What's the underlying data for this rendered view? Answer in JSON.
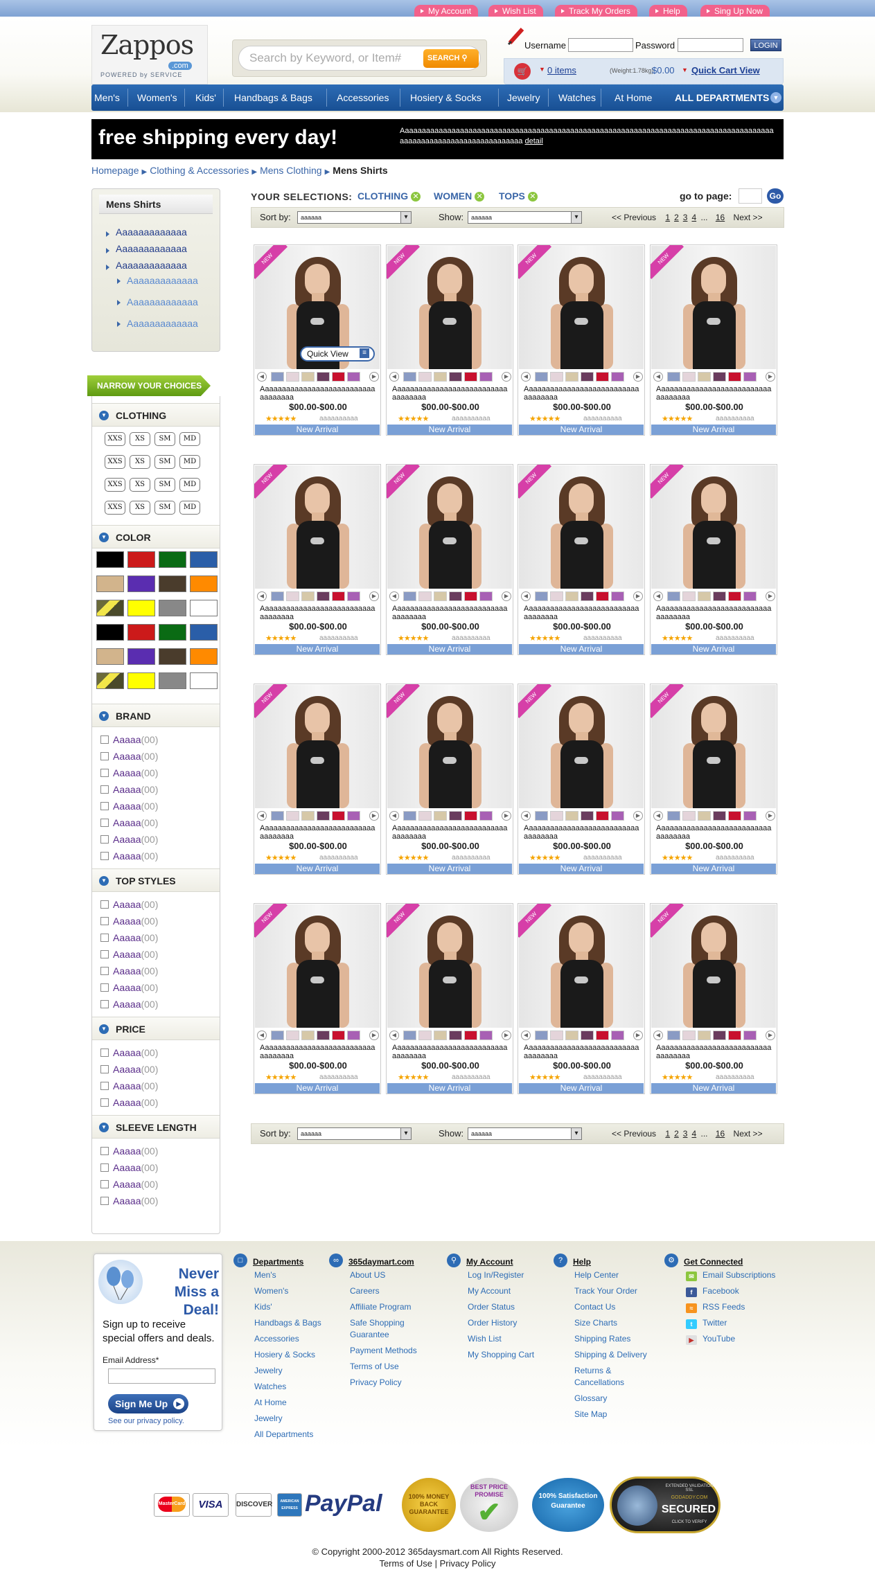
{
  "topbar": {
    "links": [
      "My Account",
      "Wish List",
      "Track My Orders",
      "Help",
      "Sing Up Now"
    ]
  },
  "header": {
    "logo": {
      "name": "Zappos",
      "suffix": ".com",
      "tagline": "POWERED by SERVICE"
    },
    "search": {
      "placeholder": "Search by Keyword, or Item#",
      "button": "SEARCH"
    },
    "login": {
      "username_label": "Username",
      "password_label": "Password",
      "button": "LOGIN"
    },
    "cart": {
      "items": "0 items",
      "weight": "(Weight:1.78kg)",
      "total": "$0.00",
      "quick_view": "Quick Cart View"
    }
  },
  "nav": {
    "items": [
      "Men's",
      "Women's",
      "Kids'",
      "Handbags & Bags",
      "Accessories",
      "Hosiery & Socks",
      "Jewelry",
      "Watches",
      "At Home"
    ],
    "all": "ALL DEPARTMENTS"
  },
  "banner": {
    "headline": "free shipping every day!",
    "text": "Aaaaaaaaaaaaaaaaaaaaaaaaaaaaaaaaaaaaaaaaaaaaaaaaaaaaaaaaaaaaaaaaaaaaaaaaaaaaaaaaaaaaaaaaaaaaaaaaaaaaaaaaaaaaaaaaaaaaa",
    "detail": "detail"
  },
  "breadcrumb": {
    "items": [
      "Homepage",
      "Clothing & Accessories",
      "Mens Clothing"
    ],
    "current": "Mens Shirts"
  },
  "sidebar": {
    "title": "Mens Shirts",
    "links": [
      "Aaaaaaaaaaaaa",
      "Aaaaaaaaaaaaa",
      "Aaaaaaaaaaaaa"
    ],
    "sublinks": [
      "Aaaaaaaaaaaaa",
      "Aaaaaaaaaaaaa",
      "Aaaaaaaaaaaaa"
    ],
    "narrow": "NARROW YOUR CHOICES",
    "sections": {
      "clothing": "CLOTHING",
      "color": "COLOR",
      "brand": "BRAND",
      "top_styles": "TOP STYLES",
      "price": "PRICE",
      "sleeve": "SLEEVE LENGTH"
    },
    "sizes": [
      "XXS",
      "XS",
      "SM",
      "MD"
    ],
    "colors": [
      "#000000",
      "#cc1a1a",
      "#0a6b14",
      "#2a5ea8",
      "#d2b48c",
      "#5a2db0",
      "#4a3c2c",
      "#ff8a00",
      "pattern",
      "#ffff00",
      "#888888",
      "#ffffff"
    ],
    "brand_item": "Aaaaa",
    "count": "(00)"
  },
  "selections": {
    "label": "YOUR SELECTIONS:",
    "items": [
      "CLOTHING",
      "WOMEN",
      "TOPS"
    ],
    "goto": "go to page:",
    "go": "Go"
  },
  "sortbar": {
    "sort_label": "Sort by:",
    "show_label": "Show:",
    "select_value": "aaaaaa",
    "prev": "<< Previous",
    "pages": [
      "1",
      "2",
      "3",
      "4"
    ],
    "ellipsis": "...",
    "last": "16",
    "next": "Next >>"
  },
  "product": {
    "ribbon": "NEW",
    "quick_view": "Quick View",
    "name": "Aaaaaaaaaaaaaaaaaaaaaaaaaaaaaaaaaaa",
    "price": "$00.00-$00.00",
    "stars": "★★★★★",
    "review": "aaaaaaaaaa",
    "new_arrival": "New Arrival",
    "swatches": [
      "#8a9bc4",
      "#e4d4da",
      "#d6c8a8",
      "#6a3c5e",
      "#c8102e",
      "#a860b4"
    ]
  },
  "footer": {
    "promo": {
      "title": "Never Miss a Deal!",
      "text": "Sign up to receive special offers and deals.",
      "email_label": "Email Address*",
      "button": "Sign Me Up",
      "privacy": "See our privacy policy."
    },
    "departments": {
      "title": "Departments",
      "links": [
        "Men's",
        "Women's",
        "Kids'",
        "Handbags & Bags",
        "Accessories",
        "Hosiery & Socks",
        "Jewelry",
        "Watches",
        "At Home",
        "Jewelry",
        "All Departments"
      ]
    },
    "site": {
      "title": "365daymart.com",
      "links": [
        "About US",
        "Careers",
        "Affiliate Program",
        "Safe Shopping",
        "Guarantee",
        "Payment Methods",
        "Terms of Use",
        "Privacy Policy"
      ]
    },
    "account": {
      "title": "My Account",
      "links": [
        "Log In/Register",
        "My Account",
        "Order Status",
        "Order History",
        "Wish List",
        "My Shopping Cart"
      ]
    },
    "help": {
      "title": "Help",
      "links": [
        "Help Center",
        "Track Your Order",
        "Contact Us",
        "Size Charts",
        "Shipping Rates",
        "Shipping & Delivery",
        "Returns &",
        "Cancellations",
        "Glossary",
        "Site Map"
      ]
    },
    "connected": {
      "title": "Get Connected",
      "links": [
        "Email Subscriptions",
        "Facebook",
        "RSS Feeds",
        "Twitter",
        "YouTube"
      ]
    },
    "payments": [
      "MasterCard",
      "VISA",
      "DISCOVER",
      "AMERICAN EXPRESS",
      "PayPal"
    ],
    "badges": {
      "money": "100% MONEY BACK GUARANTEE",
      "best": "BEST PRICE PROMISE",
      "satisfaction": "100% Satisfaction Guarantee",
      "secured": "SECURED",
      "godaddy": "GODADDY.COM",
      "ssl": "EXTENDED VALIDATION SSL",
      "verify": "CLICK TO VERIFY"
    },
    "copyright": "© Copyright 2000-2012 365daysmart.com All Rights Reserved.",
    "terms": "Terms of Use",
    "privacy": "Privacy Policy"
  }
}
